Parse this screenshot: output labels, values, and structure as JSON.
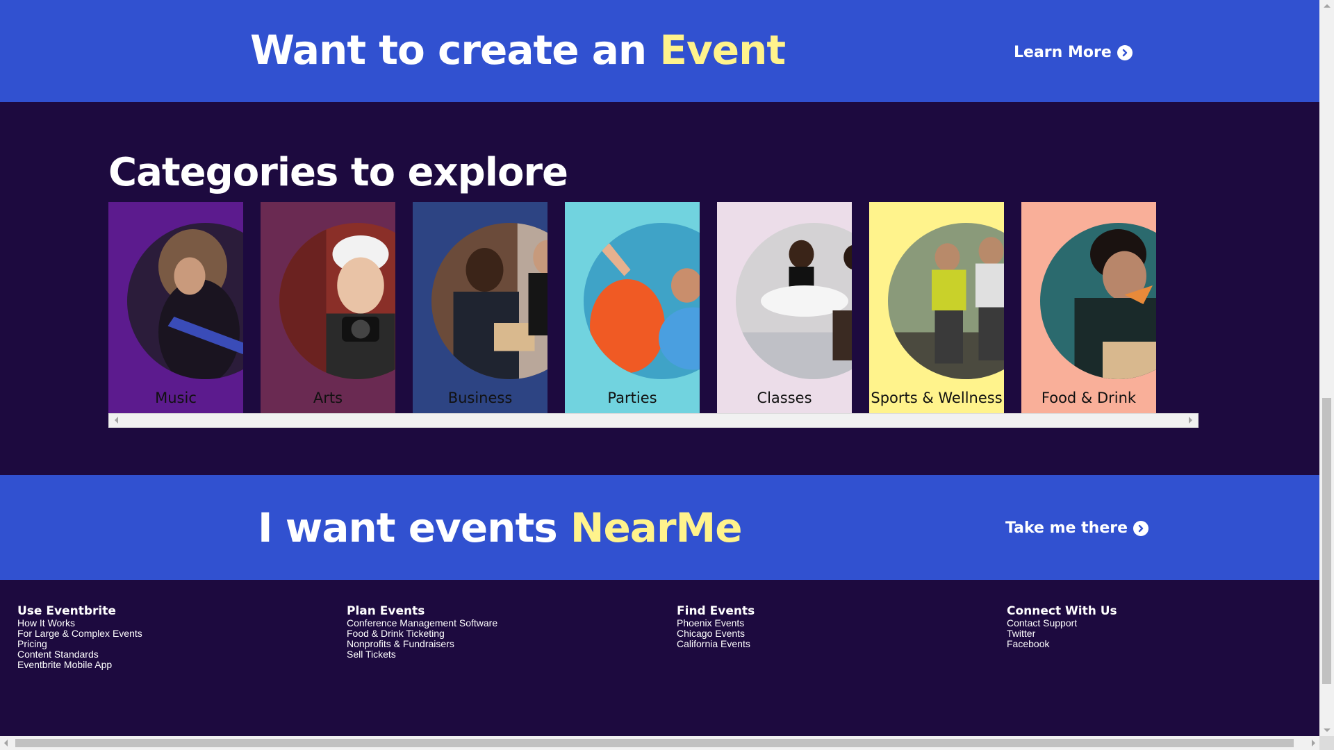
{
  "create_banner": {
    "title_prefix": "Want to create an ",
    "title_accent": "Event",
    "link_label": "Learn More",
    "bg_color": "#3151d0",
    "accent_color": "#fff38c"
  },
  "categories": {
    "title": "Categories to explore",
    "items": [
      {
        "label": "Music",
        "bg": "#5c1b8e",
        "photo": "guitarist-photo"
      },
      {
        "label": "Arts",
        "bg": "#6a2a52",
        "photo": "photographer-photo"
      },
      {
        "label": "Business",
        "bg": "#2d4483",
        "photo": "business-meeting-photo"
      },
      {
        "label": "Parties",
        "bg": "#71d3df",
        "photo": "pool-party-photo"
      },
      {
        "label": "Classes",
        "bg": "#ecdde9",
        "photo": "ballet-class-photo"
      },
      {
        "label": "Sports & Wellness",
        "bg": "#fff38c",
        "photo": "mud-run-photo"
      },
      {
        "label": "Food & Drink",
        "bg": "#f9af99",
        "photo": "eating-pizza-photo"
      }
    ]
  },
  "nearme_banner": {
    "title_prefix": "I want events ",
    "title_accent": "NearMe",
    "link_label": "Take me there"
  },
  "footer": {
    "columns": [
      {
        "heading": "Use Eventbrite",
        "links": [
          "How It Works",
          "For Large & Complex Events",
          "Pricing",
          "Content Standards",
          "Eventbrite Mobile App"
        ]
      },
      {
        "heading": "Plan Events",
        "links": [
          "Conference Management Software",
          "Food & Drink Ticketing",
          "Nonprofits & Fundraisers",
          "Sell Tickets"
        ]
      },
      {
        "heading": "Find Events",
        "links": [
          "Phoenix Events",
          "Chicago Events",
          "California Events"
        ]
      },
      {
        "heading": "Connect With Us",
        "links": [
          "Contact Support",
          "Twitter",
          "Facebook"
        ]
      }
    ]
  },
  "colors": {
    "page_bg": "#1d0a3f",
    "banner_bg": "#3151d0",
    "accent": "#fff38c"
  }
}
